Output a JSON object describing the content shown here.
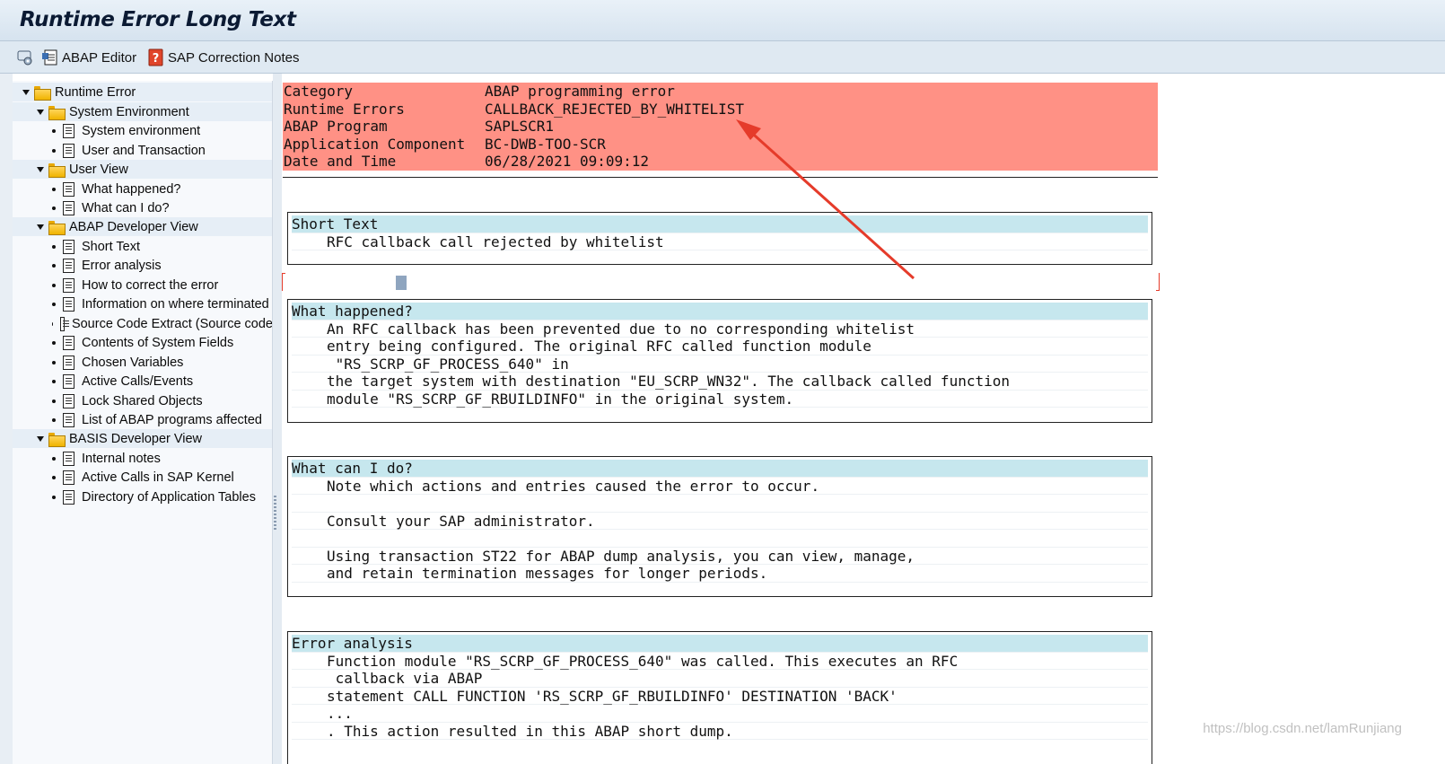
{
  "window": {
    "title": "Runtime Error Long Text"
  },
  "toolbar": {
    "abap_editor_label": "ABAP Editor",
    "correction_notes_label": "SAP Correction Notes"
  },
  "tree": {
    "root": "Runtime Error",
    "system_environment": {
      "label": "System Environment",
      "items": [
        "System environment",
        "User and Transaction"
      ]
    },
    "user_view": {
      "label": "User View",
      "items": [
        "What happened?",
        "What can I do?"
      ]
    },
    "abap_dev_view": {
      "label": "ABAP Developer View",
      "items": [
        "Short Text",
        "Error analysis",
        "How to correct the error",
        "Information on where terminated",
        "Source Code Extract (Source code",
        "Contents of System Fields",
        "Chosen Variables",
        "Active Calls/Events",
        "Lock Shared Objects",
        "List of ABAP programs affected"
      ]
    },
    "basis_dev_view": {
      "label": "BASIS Developer View",
      "items": [
        "Internal notes",
        "Active Calls in SAP Kernel",
        "Directory of Application Tables"
      ]
    }
  },
  "header": [
    {
      "key": "Category",
      "value": "ABAP programming error"
    },
    {
      "key": "Runtime Errors",
      "value": "CALLBACK_REJECTED_BY_WHITELIST"
    },
    {
      "key": "ABAP Program",
      "value": "SAPLSCR1"
    },
    {
      "key": "Application Component",
      "value": "BC-DWB-TOO-SCR"
    },
    {
      "key": "Date and Time",
      "value": "06/28/2021 09:09:12"
    }
  ],
  "short_text": {
    "heading": "Short Text",
    "lines": [
      "RFC callback call rejected by whitelist"
    ]
  },
  "what_happened": {
    "heading": "What happened?",
    "lines": [
      "An RFC callback has been prevented due to no corresponding whitelist",
      "entry being configured. The original RFC called function module",
      " \"RS_SCRP_GF_PROCESS_640\" in",
      "the target system with destination \"EU_SCRP_WN32\". The callback called function",
      "module \"RS_SCRP_GF_RBUILDINFO\" in the original system."
    ]
  },
  "what_can_i_do": {
    "heading": "What can I do?",
    "lines": [
      "Note which actions and entries caused the error to occur.",
      "",
      "Consult your SAP administrator.",
      "",
      "Using transaction ST22 for ABAP dump analysis, you can view, manage,",
      "and retain termination messages for longer periods."
    ]
  },
  "error_analysis": {
    "heading": "Error analysis",
    "lines": [
      "Function module \"RS_SCRP_GF_PROCESS_640\" was called. This executes an RFC",
      " callback via ABAP",
      "statement CALL FUNCTION 'RS_SCRP_GF_RBUILDINFO' DESTINATION 'BACK'",
      "...",
      ". This action resulted in this ABAP short dump."
    ]
  },
  "watermark": "https://blog.csdn.net/lamRunjiang",
  "colors": {
    "header_bg": "#ff9185",
    "section_head_bg": "#c6e7ee",
    "arrow": "#e53b2a"
  }
}
